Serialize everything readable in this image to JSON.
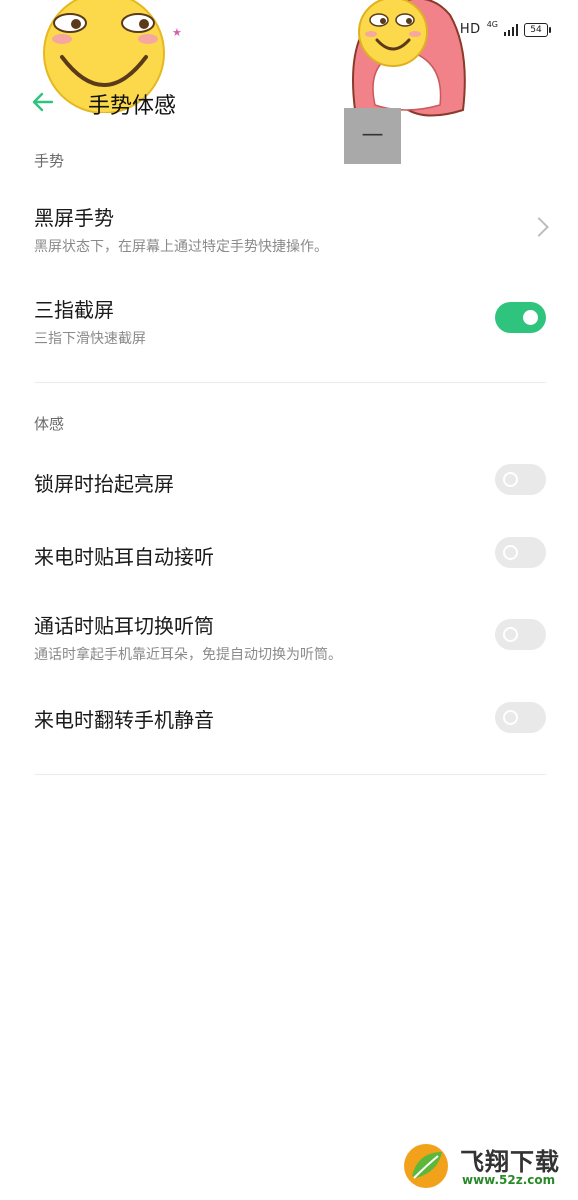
{
  "status_bar": {
    "network": "HD",
    "signal_type": "4G",
    "battery": "54"
  },
  "header": {
    "title": "手势体感",
    "back_icon": "arrow-left-icon"
  },
  "overlay": {
    "label": "—"
  },
  "sections": {
    "gesture": {
      "header": "手势",
      "items": [
        {
          "title": "黑屏手势",
          "desc": "黑屏状态下，在屏幕上通过特定手势快捷操作。",
          "control": "chevron"
        },
        {
          "title": "三指截屏",
          "desc": "三指下滑快速截屏",
          "control": "toggle",
          "on": true
        }
      ]
    },
    "motion": {
      "header": "体感",
      "items": [
        {
          "title": "锁屏时抬起亮屏",
          "desc": "",
          "control": "toggle",
          "on": false
        },
        {
          "title": "来电时贴耳自动接听",
          "desc": "",
          "control": "toggle",
          "on": false
        },
        {
          "title": "通话时贴耳切换听筒",
          "desc": "通话时拿起手机靠近耳朵，免提自动切换为听筒。",
          "control": "toggle",
          "on": false
        },
        {
          "title": "来电时翻转手机静音",
          "desc": "",
          "control": "toggle",
          "on": false
        }
      ]
    }
  },
  "watermark": {
    "brand": "飞翔下载",
    "url": "www.52z.com"
  },
  "colors": {
    "accent": "#2fc47d",
    "toggle_off": "#e9e9e9"
  }
}
